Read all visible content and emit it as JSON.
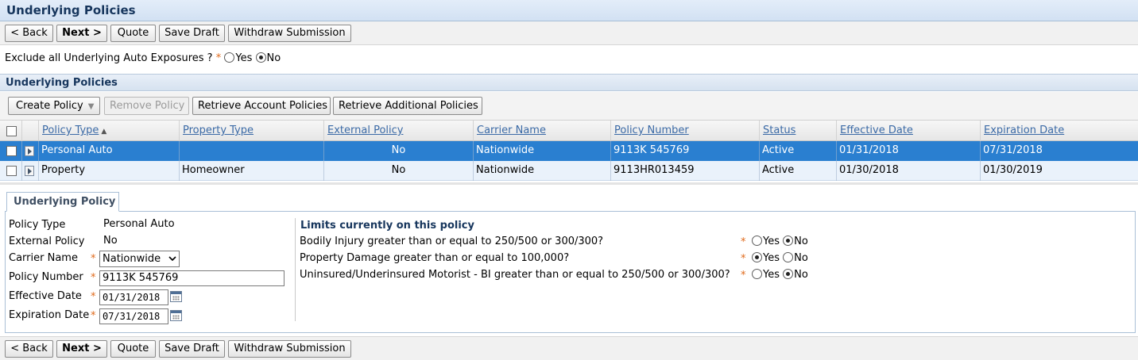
{
  "page": {
    "title": "Underlying Policies"
  },
  "toolbar": {
    "back": "< Back",
    "next": "Next >",
    "quote": "Quote",
    "save_draft": "Save Draft",
    "withdraw": "Withdraw Submission"
  },
  "exclude": {
    "label": "Exclude all Underlying Auto Exposures ?",
    "required_mark": "*",
    "yes": "Yes",
    "no": "No",
    "selected": "No"
  },
  "section": {
    "title": "Underlying Policies"
  },
  "list_toolbar": {
    "create_policy": "Create Policy",
    "remove_policy": "Remove Policy",
    "retrieve_account": "Retrieve Account Policies",
    "retrieve_additional": "Retrieve Additional Policies"
  },
  "grid": {
    "columns": [
      "Policy Type",
      "Property Type",
      "External Policy",
      "Carrier Name",
      "Policy Number",
      "Status",
      "Effective Date",
      "Expiration Date"
    ],
    "sort_indicator": "▲",
    "rows": [
      {
        "policy_type": "Personal Auto",
        "property_type": "",
        "external_policy": "No",
        "carrier_name": "Nationwide",
        "policy_number": "9113K 545769",
        "status": "Active",
        "effective_date": "01/31/2018",
        "expiration_date": "07/31/2018",
        "selected": true
      },
      {
        "policy_type": "Property",
        "property_type": "Homeowner",
        "external_policy": "No",
        "carrier_name": "Nationwide",
        "policy_number": "9113HR013459",
        "status": "Active",
        "effective_date": "01/30/2018",
        "expiration_date": "01/30/2019",
        "selected": false
      }
    ]
  },
  "detail": {
    "tab_label": "Underlying Policy",
    "required_mark": "*",
    "fields": {
      "policy_type_label": "Policy Type",
      "policy_type_value": "Personal Auto",
      "external_policy_label": "External Policy",
      "external_policy_value": "No",
      "carrier_name_label": "Carrier Name",
      "carrier_name_value": "Nationwide",
      "policy_number_label": "Policy Number",
      "policy_number_value": "9113K 545769",
      "effective_date_label": "Effective Date",
      "effective_date_value": "01/31/2018",
      "expiration_date_label": "Expiration Date",
      "expiration_date_value": "07/31/2018"
    },
    "limits": {
      "title": "Limits currently on this policy",
      "yes": "Yes",
      "no": "No",
      "questions": [
        {
          "text": "Bodily Injury greater than or equal to 250/500 or 300/300?",
          "selected": "No"
        },
        {
          "text": "Property Damage greater than or equal to 100,000?",
          "selected": "Yes"
        },
        {
          "text": "Uninsured/Underinsured Motorist - BI greater than or equal to 250/500 or 300/300?",
          "selected": "No"
        }
      ]
    }
  },
  "colors": {
    "selected_row": "#2a7fd0",
    "alt_row": "#eaf2fb",
    "required": "#e06a1b",
    "header_text": "#17365d",
    "link": "#3b6aa6"
  }
}
